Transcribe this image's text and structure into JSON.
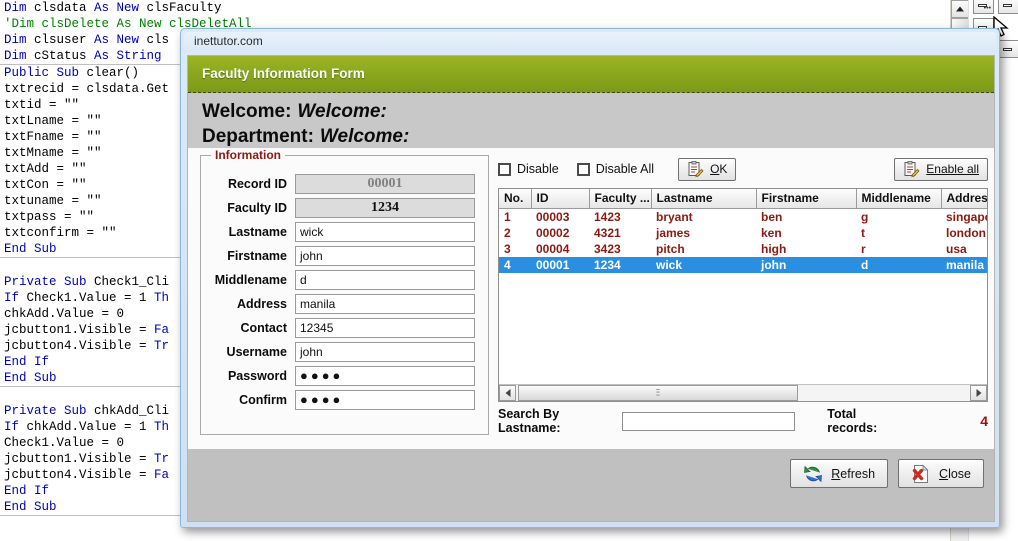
{
  "editor": {
    "lines": [
      {
        "t": "code",
        "segs": [
          {
            "c": "kw",
            "s": "Dim"
          },
          {
            "c": "",
            "s": " clsdata "
          },
          {
            "c": "kw",
            "s": "As New"
          },
          {
            "c": "",
            "s": " clsFaculty"
          }
        ]
      },
      {
        "t": "code",
        "segs": [
          {
            "c": "cm",
            "s": "'Dim clsDelete As New clsDeletAll"
          }
        ]
      },
      {
        "t": "code",
        "segs": [
          {
            "c": "kw",
            "s": "Dim"
          },
          {
            "c": "",
            "s": " clsuser "
          },
          {
            "c": "kw",
            "s": "As New"
          },
          {
            "c": "",
            "s": " cls"
          }
        ]
      },
      {
        "t": "code",
        "segs": [
          {
            "c": "kw",
            "s": "Dim"
          },
          {
            "c": "",
            "s": " cStatus "
          },
          {
            "c": "kw",
            "s": "As String"
          }
        ]
      },
      {
        "t": "rule"
      },
      {
        "t": "code",
        "segs": [
          {
            "c": "kw",
            "s": "Public Sub"
          },
          {
            "c": "",
            "s": " clear()"
          }
        ]
      },
      {
        "t": "code",
        "segs": [
          {
            "c": "",
            "s": "txtrecid = clsdata.Get"
          }
        ]
      },
      {
        "t": "code",
        "segs": [
          {
            "c": "",
            "s": "txtid = \"\""
          }
        ]
      },
      {
        "t": "code",
        "segs": [
          {
            "c": "",
            "s": "txtLname = \"\""
          }
        ]
      },
      {
        "t": "code",
        "segs": [
          {
            "c": "",
            "s": "txtFname = \"\""
          }
        ]
      },
      {
        "t": "code",
        "segs": [
          {
            "c": "",
            "s": "txtMname = \"\""
          }
        ]
      },
      {
        "t": "code",
        "segs": [
          {
            "c": "",
            "s": "txtAdd = \"\""
          }
        ]
      },
      {
        "t": "code",
        "segs": [
          {
            "c": "",
            "s": "txtCon = \"\""
          }
        ]
      },
      {
        "t": "code",
        "segs": [
          {
            "c": "",
            "s": "txtuname = \"\""
          }
        ]
      },
      {
        "t": "code",
        "segs": [
          {
            "c": "",
            "s": "txtpass = \"\""
          }
        ]
      },
      {
        "t": "code",
        "segs": [
          {
            "c": "",
            "s": "txtconfirm = \"\""
          }
        ]
      },
      {
        "t": "code",
        "segs": [
          {
            "c": "kw",
            "s": "End Sub"
          }
        ]
      },
      {
        "t": "rule"
      },
      {
        "t": "blank"
      },
      {
        "t": "code",
        "segs": [
          {
            "c": "kw",
            "s": "Private Sub"
          },
          {
            "c": "",
            "s": " Check1_Cli"
          }
        ]
      },
      {
        "t": "code",
        "segs": [
          {
            "c": "kw",
            "s": "If"
          },
          {
            "c": "",
            "s": " Check1.Value = 1 "
          },
          {
            "c": "kw",
            "s": "Th"
          }
        ]
      },
      {
        "t": "code",
        "segs": [
          {
            "c": "",
            "s": "chkAdd.Value = 0"
          }
        ]
      },
      {
        "t": "code",
        "segs": [
          {
            "c": "",
            "s": "jcbutton1.Visible = "
          },
          {
            "c": "kw",
            "s": "Fa"
          }
        ]
      },
      {
        "t": "code",
        "segs": [
          {
            "c": "",
            "s": "jcbutton4.Visible = "
          },
          {
            "c": "kw",
            "s": "Tr"
          }
        ]
      },
      {
        "t": "code",
        "segs": [
          {
            "c": "kw",
            "s": "End If"
          }
        ]
      },
      {
        "t": "code",
        "segs": [
          {
            "c": "kw",
            "s": "End Sub"
          }
        ]
      },
      {
        "t": "rule"
      },
      {
        "t": "blank"
      },
      {
        "t": "code",
        "segs": [
          {
            "c": "kw",
            "s": "Private Sub"
          },
          {
            "c": "",
            "s": " chkAdd_Cli"
          }
        ]
      },
      {
        "t": "code",
        "segs": [
          {
            "c": "kw",
            "s": "If"
          },
          {
            "c": "",
            "s": " chkAdd.Value = 1 "
          },
          {
            "c": "kw",
            "s": "Th"
          }
        ]
      },
      {
        "t": "code",
        "segs": [
          {
            "c": "",
            "s": "Check1.Value = 0"
          }
        ]
      },
      {
        "t": "code",
        "segs": [
          {
            "c": "",
            "s": "jcbutton1.Visible = "
          },
          {
            "c": "kw",
            "s": "Tr"
          }
        ]
      },
      {
        "t": "code",
        "segs": [
          {
            "c": "",
            "s": "jcbutton4.Visible = "
          },
          {
            "c": "kw",
            "s": "Fa"
          }
        ]
      },
      {
        "t": "code",
        "segs": [
          {
            "c": "kw",
            "s": "End If"
          }
        ]
      },
      {
        "t": "code",
        "segs": [
          {
            "c": "kw",
            "s": "End Sub"
          }
        ]
      },
      {
        "t": "rule"
      }
    ]
  },
  "dialog": {
    "titlebar": "inettutor.com",
    "banner_title": "Faculty Information Form",
    "welcome_label": "Welcome:",
    "welcome_value": "Welcome:",
    "department_label": "Department:",
    "department_value": "Welcome:"
  },
  "information": {
    "legend": "Information",
    "fields": [
      {
        "label": "Record ID",
        "value": "00001",
        "type": "readonly-dim"
      },
      {
        "label": "Faculty ID",
        "value": "1234",
        "type": "readonly"
      },
      {
        "label": "Lastname",
        "value": "wick",
        "type": "text"
      },
      {
        "label": "Firstname",
        "value": "john",
        "type": "text"
      },
      {
        "label": "Middlename",
        "value": "d",
        "type": "text"
      },
      {
        "label": "Address",
        "value": "manila",
        "type": "text"
      },
      {
        "label": "Contact",
        "value": "12345",
        "type": "text"
      },
      {
        "label": "Username",
        "value": "john",
        "type": "text"
      },
      {
        "label": "Password",
        "value": "●●●●",
        "type": "password"
      },
      {
        "label": "Confirm",
        "value": "●●●●",
        "type": "password"
      }
    ]
  },
  "controls": {
    "disable_label": "Disable",
    "disable_all_label": "Disable All",
    "ok_label": "OK",
    "ok_accel": "O",
    "enable_all_label": "Enable all",
    "enable_all_accel": "E"
  },
  "table": {
    "columns": [
      "No.",
      "ID",
      "Faculty ...",
      "Lastname",
      "Firstname",
      "Middlename",
      "Address"
    ],
    "rows": [
      {
        "cells": [
          "1",
          "00003",
          "1423",
          "bryant",
          "ben",
          "g",
          "singapore"
        ],
        "selected": false
      },
      {
        "cells": [
          "2",
          "00002",
          "4321",
          "james",
          "ken",
          "t",
          "london"
        ],
        "selected": false
      },
      {
        "cells": [
          "3",
          "00004",
          "3423",
          "pitch",
          "high",
          "r",
          "usa"
        ],
        "selected": false
      },
      {
        "cells": [
          "4",
          "00001",
          "1234",
          "wick",
          "john",
          "d",
          "manila"
        ],
        "selected": true
      }
    ]
  },
  "search": {
    "label": "Search By Lastname:",
    "value": "",
    "placeholder": "",
    "total_label": "Total records:",
    "total_value": "4"
  },
  "footer": {
    "refresh_label": "Refresh",
    "refresh_accel": "R",
    "close_label": "Close",
    "close_accel": "C"
  },
  "colors": {
    "banner_green": "#8aa51d",
    "data_text_red": "#8a1a12",
    "selection_blue": "#2a8fe0",
    "dialog_border_blue": "#8bb7dd"
  }
}
